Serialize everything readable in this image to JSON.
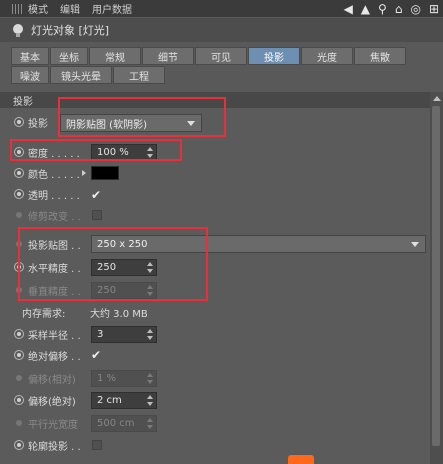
{
  "menu": {
    "items": [
      "模式",
      "编辑",
      "用户数据"
    ]
  },
  "nav_icons": [
    "arrow-left-icon",
    "arrow-up-icon",
    "search-icon",
    "home-icon",
    "target-icon",
    "plus-icon"
  ],
  "object": {
    "title": "灯光对象 [灯光]"
  },
  "tabs": {
    "row1": [
      "基本",
      "坐标",
      "常规",
      "细节",
      "可见",
      "投影",
      "光度",
      "焦散"
    ],
    "row2": [
      "噪波",
      "镜头光晕",
      "工程"
    ],
    "active": "投影"
  },
  "section": {
    "title": "投影"
  },
  "shadow": {
    "label": "投影",
    "value": "阴影贴图 (软阴影)"
  },
  "density": {
    "label": "密度 . . . . .",
    "value": "100 %"
  },
  "color": {
    "label": "颜色 . . . . .",
    "swatch": "#000000"
  },
  "transparency": {
    "label": "透明 . . . . .",
    "checked": true
  },
  "clip": {
    "label": "修剪改变 . .",
    "checked": false
  },
  "shadow_map": {
    "label": "投影贴图 . .",
    "value": "250 x 250"
  },
  "h_res": {
    "label": "水平精度 . .",
    "value": "250"
  },
  "v_res": {
    "label": "垂直精度 . .",
    "value": "250"
  },
  "memory": {
    "label": "内存需求:",
    "value": "大约 3.0 MB"
  },
  "samples": {
    "label": "采样半径 . .",
    "value": "3"
  },
  "abs_bias": {
    "label": "绝对偏移 . .",
    "checked": true
  },
  "rel_bias": {
    "label": "偏移(相对)",
    "value": "1 %"
  },
  "bias_abs": {
    "label": "偏移(绝对)",
    "value": "2 cm"
  },
  "parallel": {
    "label": "平行光宽度",
    "value": "500 cm"
  },
  "outline": {
    "label": "轮廓投影 . .",
    "checked": false
  },
  "accent": {
    "active_tab": "#6f8fb2",
    "annotation": "#e8303a"
  }
}
